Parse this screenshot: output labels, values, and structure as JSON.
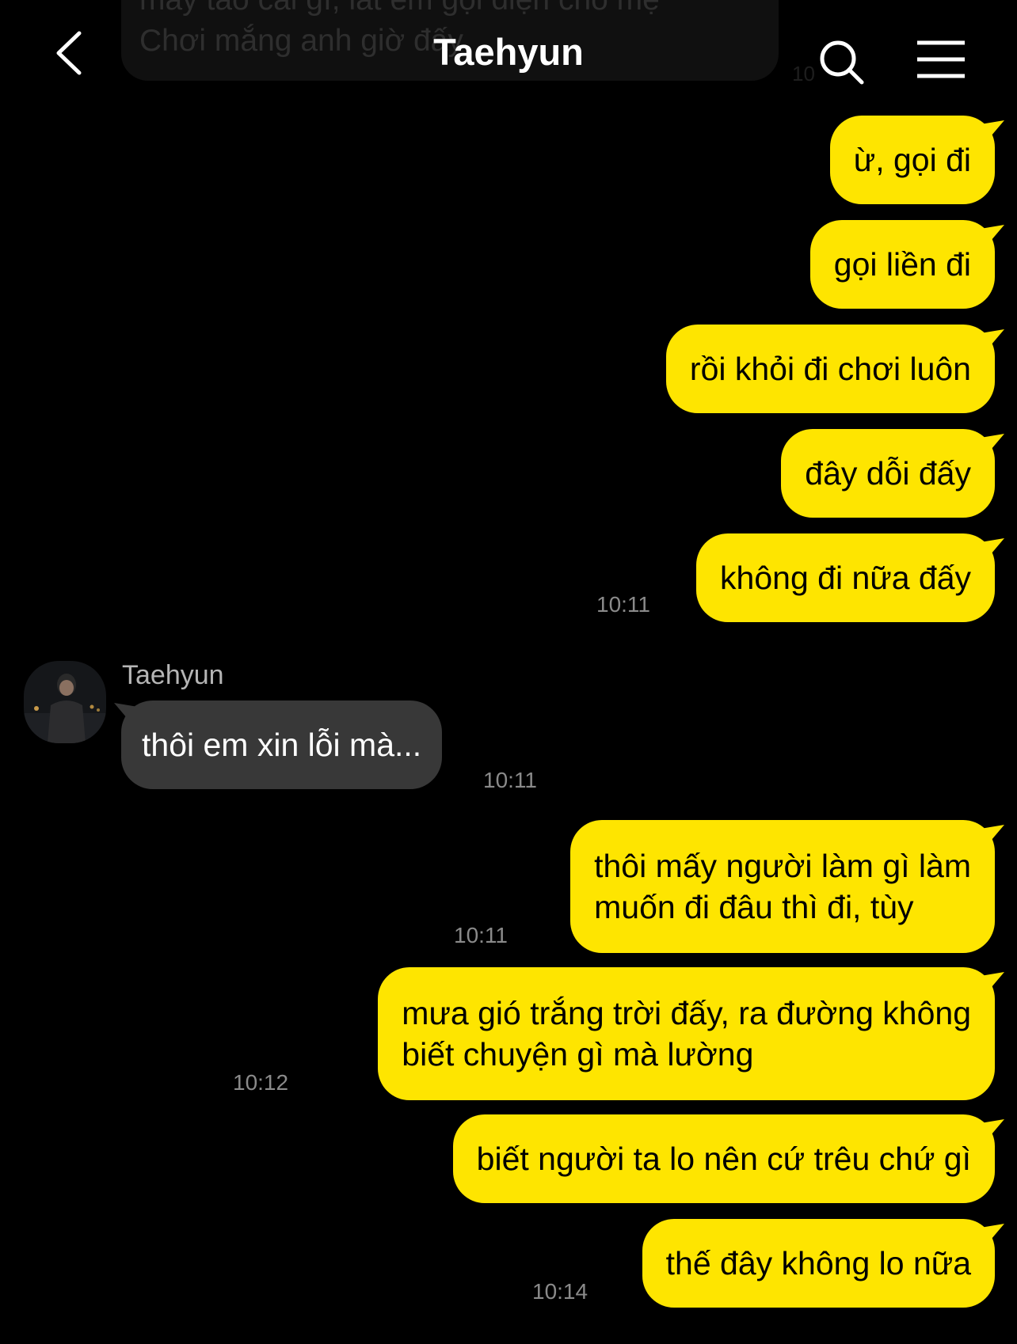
{
  "header": {
    "title": "Taehyun",
    "back_icon": "chevron-left-icon",
    "search_icon": "search-icon",
    "menu_icon": "hamburger-menu-icon"
  },
  "previous_message": {
    "line1": "mày tao cái gì, lát em gọi điện cho mẹ",
    "line2": "Chơi mắng anh giờ đấy",
    "time": "10"
  },
  "colors": {
    "my_bubble": "#fee500",
    "their_bubble": "#383838",
    "background": "#000000",
    "time_text": "#8a8a8a"
  },
  "messages": [
    {
      "from": "me",
      "lines": [
        "ừ, gọi đi"
      ],
      "time": ""
    },
    {
      "from": "me",
      "lines": [
        "gọi liền đi"
      ],
      "time": ""
    },
    {
      "from": "me",
      "lines": [
        "rồi khỏi đi chơi luôn"
      ],
      "time": ""
    },
    {
      "from": "me",
      "lines": [
        "đây dỗi đấy"
      ],
      "time": ""
    },
    {
      "from": "me",
      "lines": [
        "không đi nữa đấy"
      ],
      "time": "10:11"
    },
    {
      "from": "them",
      "sender": "Taehyun",
      "lines": [
        "thôi em xin lỗi mà..."
      ],
      "time": "10:11"
    },
    {
      "from": "me",
      "lines": [
        "thôi mấy người làm gì làm",
        "muốn đi đâu thì đi, tùy"
      ],
      "time": "10:11"
    },
    {
      "from": "me",
      "lines": [
        "mưa gió trắng trời đấy, ra đường không",
        "biết chuyện gì mà lường"
      ],
      "time": "10:12"
    },
    {
      "from": "me",
      "lines": [
        "biết người ta lo nên cứ trêu chứ gì"
      ],
      "time": ""
    },
    {
      "from": "me",
      "lines": [
        "thế đây không lo nữa"
      ],
      "time": "10:14"
    }
  ]
}
